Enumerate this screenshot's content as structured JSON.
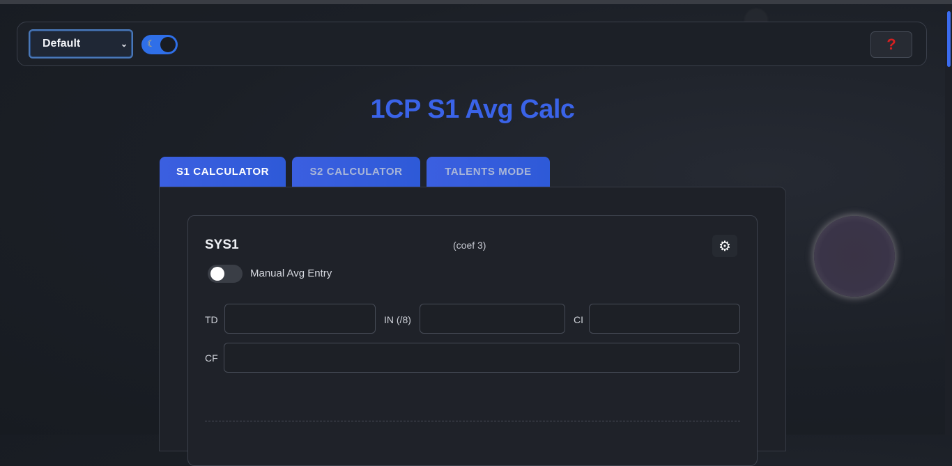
{
  "header": {
    "theme_select": {
      "value": "Default"
    },
    "dark_mode_toggle": {
      "icon": "moon-icon",
      "on": true
    },
    "help_button": {
      "label": "?"
    }
  },
  "title": "1CP S1 Avg Calc",
  "tabs": [
    {
      "label": "S1 CALCULATOR",
      "active": true
    },
    {
      "label": "S2 CALCULATOR",
      "active": false
    },
    {
      "label": "TALENTS MODE",
      "active": false
    }
  ],
  "subject": {
    "name": "SYS1",
    "coef": "(coef 3)",
    "settings_icon": "gear-icon",
    "manual_avg": {
      "label": "Manual Avg Entry",
      "on": false
    },
    "fields": [
      {
        "label": "TD",
        "value": ""
      },
      {
        "label": "IN (/8)",
        "value": ""
      },
      {
        "label": "CI",
        "value": ""
      },
      {
        "label": "CF",
        "value": ""
      }
    ]
  },
  "colors": {
    "accent": "#3a63e8",
    "toggle_on": "#2f6fe8",
    "help_icon": "#d42020",
    "background": "#1b1f26"
  }
}
